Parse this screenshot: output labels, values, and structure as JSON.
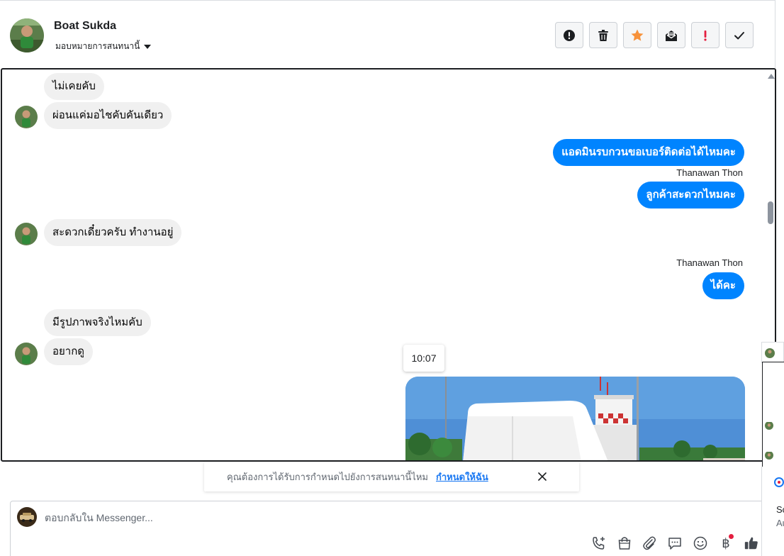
{
  "header": {
    "name": "Boat Sukda",
    "assign_label": "มอบหมายการสนทนานี้"
  },
  "messages": {
    "m1": "ไม่เคยคับ",
    "m2": "ผ่อนแค่มอไชคับคันเดียว",
    "m3": "แอดมินรบกวนขอเบอร์ติดต่อได้ไหมคะ",
    "m3_sender": "Thanawan Thon",
    "m4": "ลูกค้าสะดวกไหมคะ",
    "m5": "สะดวกเดี๋ยวครับ ทำงานอยู่",
    "m6_sender": "Thanawan Thon",
    "m6": "ได้คะ",
    "m7": "มีรูปภาพจริงไหมคับ",
    "m8": "อยากดู",
    "timestamp": "10:07"
  },
  "notice": {
    "text": "คุณต้องการได้รับการกำหนดไปยังการสนทนานี้ไหม",
    "link": "กำหนดให้ฉัน"
  },
  "composer": {
    "placeholder": "ตอบกลับใน Messenger...",
    "currency_symbol": "฿"
  },
  "side_popup": {
    "line1": "Scr",
    "line2": "Au"
  },
  "colors": {
    "outgoing_bubble": "#0084ff",
    "incoming_bubble": "#f0f0f0",
    "star": "#f7923b",
    "spam": "#e41e3f",
    "link": "#1877f2"
  }
}
